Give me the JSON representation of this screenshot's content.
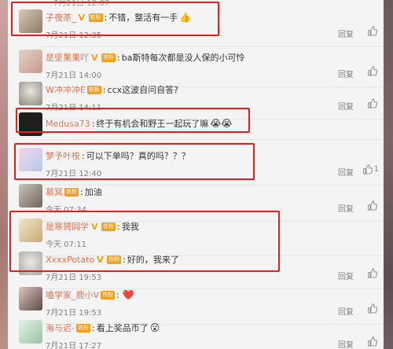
{
  "top_cut_time": "7月21日 12:07",
  "actions": {
    "reply_label": "回复"
  },
  "fan_badge_label": "铁粉",
  "comments": [
    {
      "username": "子夜茶_",
      "verified": true,
      "fan": true,
      "text": "不错，整活有一手",
      "emoji": "👍",
      "time": "7月21日 12:35",
      "likes": "",
      "reply": true
    },
    {
      "username": "是坚果果吖",
      "verified": true,
      "fan": true,
      "text": "ba斯特每次都是没人保的小可怜",
      "emoji": "",
      "time": "7月21日 14:00",
      "likes": "",
      "reply": true
    },
    {
      "username": "W冲冲冲E",
      "verified": false,
      "fan": true,
      "text": "ccx这波自问自答?",
      "emoji": "",
      "time": "7月21日 14:11",
      "likes": "",
      "reply": true
    },
    {
      "username": "Medusa73",
      "verified": false,
      "fan": false,
      "text": "终于有机会和野王一起玩了嘛",
      "emoji": "😭😭",
      "time": "",
      "likes": "",
      "reply": false
    },
    {
      "username": "梦予叶桉",
      "verified": false,
      "fan": false,
      "text": "可以下单吗？真的吗？？？",
      "emoji": "",
      "time": "7月21日 12:40",
      "likes": "1",
      "reply": true
    },
    {
      "username": "慕冥",
      "verified": false,
      "fan": true,
      "text": "加油",
      "emoji": "",
      "time": "今天 07:34",
      "likes": "",
      "reply": true
    },
    {
      "username": "是寒赟同学",
      "verified": true,
      "fan": true,
      "text": "我我",
      "emoji": "",
      "time": "今天 07:11",
      "likes": "",
      "reply": true
    },
    {
      "username": "XxxxPotato",
      "verified": true,
      "fan": true,
      "text": "好的，我来了",
      "emoji": "",
      "time": "7月21日 19:53",
      "likes": "",
      "reply": true
    },
    {
      "username": "嗑学家_鹿小V",
      "verified": false,
      "fan": true,
      "text": "",
      "emoji": "❤️",
      "time": "7月21日 19:53",
      "likes": "",
      "reply": true
    },
    {
      "username": "海与迟-",
      "verified": false,
      "fan": true,
      "text": "看上奖品币了",
      "emoji": "😮",
      "time": "7月21日 17:27",
      "likes": "",
      "reply": true
    }
  ]
}
